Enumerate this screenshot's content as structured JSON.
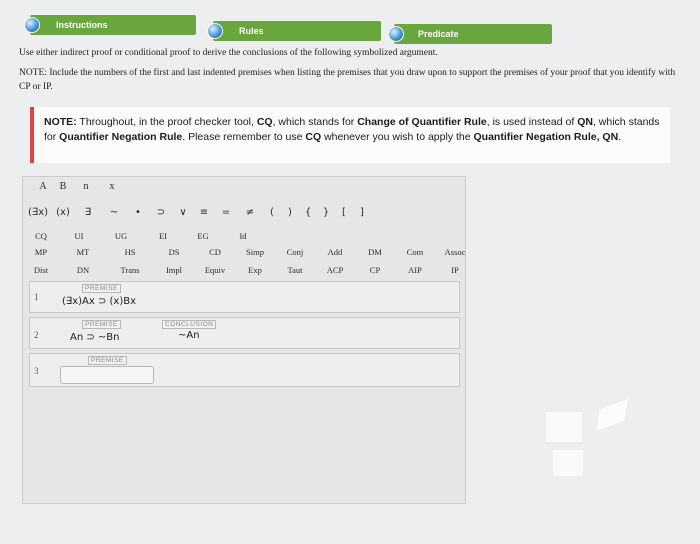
{
  "tabs": [
    {
      "label": "Instructions"
    },
    {
      "label": "Rules"
    },
    {
      "label": "Predicate"
    }
  ],
  "instructions": {
    "line1": "Use either indirect proof or conditional proof to derive the conclusions of the following symbolized argument.",
    "line2": "NOTE: Include the numbers of the first and last indented premises when listing the premises that you draw upon to support the premises of your proof that you identify with CP or IP."
  },
  "note": {
    "prefix": "NOTE:",
    "t1": " Throughout, in the proof checker tool, ",
    "cq": "CQ",
    "t2": ", which stands for ",
    "cqr": "Change of Quantifier Rule",
    "t3": ", is used instead of ",
    "qn": "QN",
    "t4": ", which stands for ",
    "qnr": "Quantifier Negation Rule",
    "t5": ". Please remember to use ",
    "cq2": "CQ",
    "t6": " whenever you wish to apply the ",
    "qnr2": "Quantifier Negation Rule, QN",
    "t7": "."
  },
  "toolbar": {
    "letters": [
      "A",
      "B",
      "n",
      "x"
    ],
    "symbols": [
      "(∃x)",
      "(x)",
      "∃",
      "~",
      "•",
      "⊃",
      "∨",
      "≡",
      "=",
      "≠",
      "(",
      ")",
      "{",
      "}",
      "[",
      "]"
    ],
    "rules_row1": [
      "CQ",
      "UI",
      "UG",
      "EI",
      "EG",
      "Id"
    ],
    "rules_row2": [
      "MP",
      "MT",
      "HS",
      "DS",
      "CD",
      "Simp",
      "Conj",
      "Add",
      "DM",
      "Com",
      "Assoc"
    ],
    "rules_row3": [
      "Dist",
      "DN",
      "Trans",
      "Impl",
      "Equiv",
      "Exp",
      "Taut",
      "ACP",
      "CP",
      "AIP",
      "IP"
    ]
  },
  "proof": {
    "lines": [
      {
        "num": "1",
        "tag": "PREMISE",
        "formula": "(∃x)Ax ⊃ (x)Bx"
      },
      {
        "num": "2",
        "tag": "PREMISE",
        "formula": "An ⊃ ~Bn",
        "conc_tag": "CONCLUSION",
        "conclusion": "~An"
      },
      {
        "num": "3",
        "tag": "PREMISE",
        "formula": ""
      }
    ]
  }
}
